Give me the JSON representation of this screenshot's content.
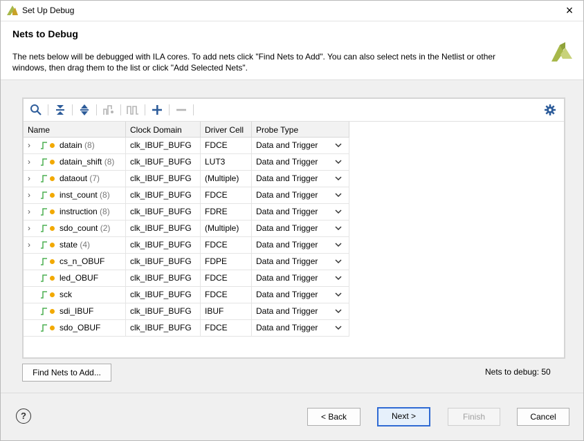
{
  "window": {
    "title": "Set Up Debug",
    "close_label": "×"
  },
  "header": {
    "title": "Nets to Debug",
    "description": "The nets below will be debugged with ILA cores. To add nets click \"Find Nets to Add\". You can also select nets in the Netlist or other windows, then drag them to the list or click \"Add Selected Nets\"."
  },
  "toolbar": {
    "icons": [
      "search-icon",
      "collapse-all-icon",
      "expand-all-icon",
      "probe-type-icon",
      "pulse-icon",
      "add-icon",
      "remove-icon",
      "settings-icon"
    ]
  },
  "table": {
    "columns": [
      "Name",
      "Clock Domain",
      "Driver Cell",
      "Probe Type"
    ],
    "rows": [
      {
        "expandable": true,
        "name": "datain",
        "count": "(8)",
        "clock": "clk_IBUF_BUFG",
        "driver": "FDCE",
        "probe": "Data and Trigger"
      },
      {
        "expandable": true,
        "name": "datain_shift",
        "count": "(8)",
        "clock": "clk_IBUF_BUFG",
        "driver": "LUT3",
        "probe": "Data and Trigger"
      },
      {
        "expandable": true,
        "name": "dataout",
        "count": "(7)",
        "clock": "clk_IBUF_BUFG",
        "driver": "(Multiple)",
        "probe": "Data and Trigger"
      },
      {
        "expandable": true,
        "name": "inst_count",
        "count": "(8)",
        "clock": "clk_IBUF_BUFG",
        "driver": "FDCE",
        "probe": "Data and Trigger"
      },
      {
        "expandable": true,
        "name": "instruction",
        "count": "(8)",
        "clock": "clk_IBUF_BUFG",
        "driver": "FDRE",
        "probe": "Data and Trigger"
      },
      {
        "expandable": true,
        "name": "sdo_count",
        "count": "(2)",
        "clock": "clk_IBUF_BUFG",
        "driver": "(Multiple)",
        "probe": "Data and Trigger"
      },
      {
        "expandable": true,
        "name": "state",
        "count": "(4)",
        "clock": "clk_IBUF_BUFG",
        "driver": "FDCE",
        "probe": "Data and Trigger"
      },
      {
        "expandable": false,
        "name": "cs_n_OBUF",
        "count": "",
        "clock": "clk_IBUF_BUFG",
        "driver": "FDPE",
        "probe": "Data and Trigger"
      },
      {
        "expandable": false,
        "name": "led_OBUF",
        "count": "",
        "clock": "clk_IBUF_BUFG",
        "driver": "FDCE",
        "probe": "Data and Trigger"
      },
      {
        "expandable": false,
        "name": "sck",
        "count": "",
        "clock": "clk_IBUF_BUFG",
        "driver": "FDCE",
        "probe": "Data and Trigger"
      },
      {
        "expandable": false,
        "name": "sdi_IBUF",
        "count": "",
        "clock": "clk_IBUF_BUFG",
        "driver": "IBUF",
        "probe": "Data and Trigger"
      },
      {
        "expandable": false,
        "name": "sdo_OBUF",
        "count": "",
        "clock": "clk_IBUF_BUFG",
        "driver": "FDCE",
        "probe": "Data and Trigger"
      }
    ]
  },
  "footer": {
    "find_nets_label": "Find Nets to Add...",
    "nets_count_label": "Nets to debug: 50",
    "help_label": "?",
    "back_label": "< Back",
    "next_label": "Next >",
    "finish_label": "Finish",
    "cancel_label": "Cancel"
  },
  "colors": {
    "accent": "#2f6ad3",
    "logo_green": "#a7b84a",
    "signal_green": "#4caf50",
    "dot_orange": "#f2a900"
  }
}
